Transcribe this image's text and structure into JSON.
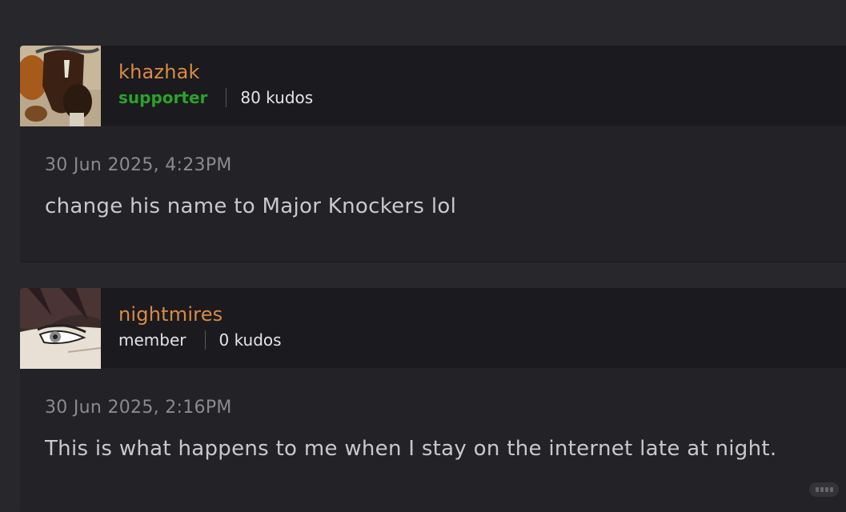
{
  "comments": [
    {
      "username": "khazhak",
      "role": "supporter",
      "kudos": "80 kudos",
      "date": "30 Jun 2025, 4:23PM",
      "text": "change his name to Major Knockers lol"
    },
    {
      "username": "nightmires",
      "role": "member",
      "kudos": "0 kudos",
      "date": "30 Jun 2025, 2:16PM",
      "text": "This is what happens to me when I stay on the internet late at night."
    }
  ],
  "colors": {
    "background": "#28272c",
    "card": "#232227",
    "header": "#1b1a1e",
    "username": "#d98b44",
    "supporter": "#2aa32a"
  }
}
